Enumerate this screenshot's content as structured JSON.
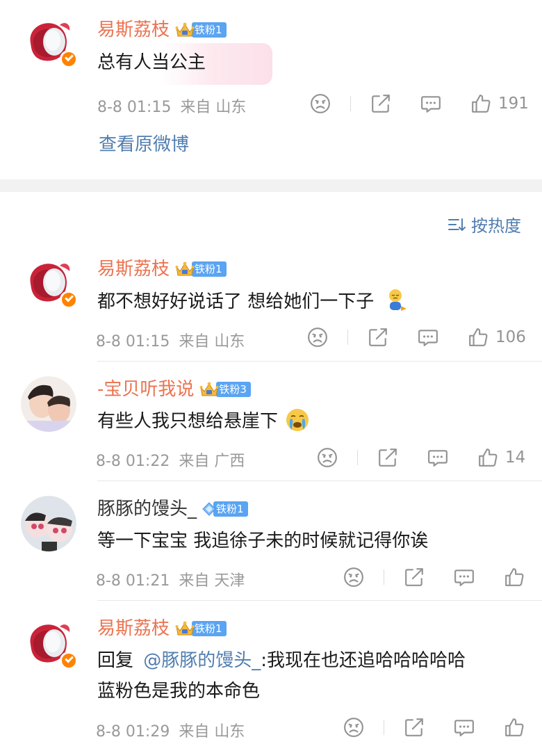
{
  "top_comment": {
    "username": "易斯荔枝",
    "fan_level": "铁粉1",
    "text": "总有人当公主",
    "time": "8-8 01:15",
    "source": "来自 山东",
    "likes": "191",
    "view_original": "查看原微博"
  },
  "sort": {
    "label": "按热度"
  },
  "comments": [
    {
      "username": "易斯荔枝",
      "fan_level": "铁粉1",
      "text": "都不想好好说话了 想给她们一下子",
      "time": "8-8 01:15",
      "source": "来自 山东",
      "likes": "106"
    },
    {
      "username": "-宝贝听我说",
      "fan_level": "铁粉3",
      "text": "有些人我只想给悬崖下",
      "time": "8-8 01:22",
      "source": "来自 广西",
      "likes": "14"
    },
    {
      "username": "豚豚的馒头_",
      "fan_level": "铁粉1",
      "text": "等一下宝宝 我追徐子未的时候就记得你诶",
      "time": "8-8 01:21",
      "source": "来自 天津",
      "likes": ""
    },
    {
      "username": "易斯荔枝",
      "fan_level": "铁粉1",
      "reply_prefix": "回复",
      "mention": "@豚豚的馒头_",
      "text_after": ":我现在也还追哈哈哈哈哈",
      "text_line2": "蓝粉色是我的本命色",
      "time": "8-8 01:29",
      "source": "来自 山东",
      "likes": ""
    }
  ],
  "colors": {
    "username_orange": "#eb7350",
    "link_blue": "#507daf",
    "fan_badge_blue": "#5aa4f2",
    "verified_orange": "#ff8200",
    "meta_gray": "#999999"
  },
  "icons": [
    "verified-badge-icon",
    "crown-icon",
    "diamond-icon",
    "dislike-face-icon",
    "share-icon",
    "comment-icon",
    "like-thumb-icon",
    "sort-icon",
    "sleepy-emoji-icon",
    "crying-emoji-icon"
  ]
}
